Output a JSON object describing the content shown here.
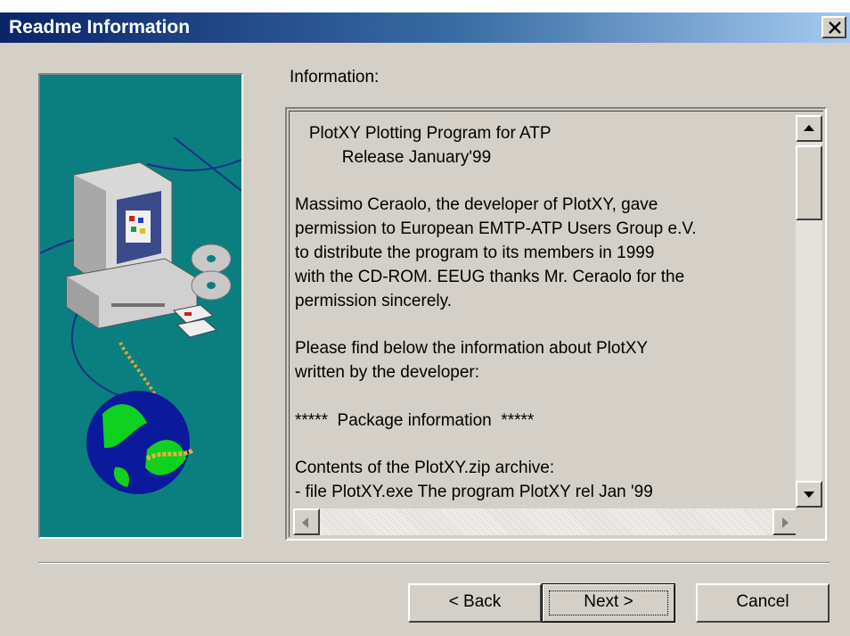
{
  "window": {
    "title": "Readme Information",
    "close_icon": "close-icon"
  },
  "info_label": "Information:",
  "readme_lines": [
    "   PlotXY Plotting Program for ATP",
    "          Release January'99",
    "",
    "Massimo Ceraolo, the developer of PlotXY, gave",
    "permission to European EMTP-ATP Users Group e.V.",
    "to distribute the program to its members in 1999",
    "with the CD-ROM. EEUG thanks Mr. Ceraolo for the",
    "permission sincerely.",
    "",
    "Please find below the information about PlotXY",
    "written by the developer:",
    "",
    "*****  Package information  *****",
    "",
    "Contents of the PlotXY.zip archive:",
    "- file PlotXY.exe The program PlotXY rel Jan '99"
  ],
  "buttons": {
    "back": "< Back",
    "next": "Next >",
    "cancel": "Cancel"
  },
  "icons": [
    "computer-illustration",
    "scroll-up-icon",
    "scroll-down-icon",
    "scroll-left-icon",
    "scroll-right-icon"
  ]
}
